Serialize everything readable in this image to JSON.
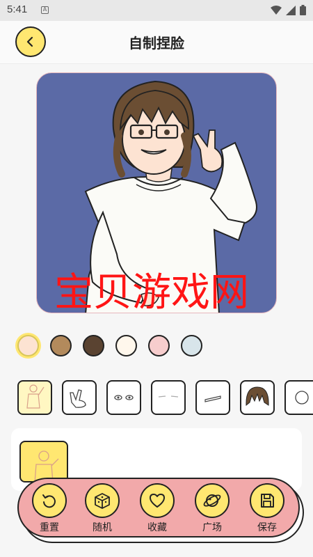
{
  "status": {
    "time": "5:41",
    "notification_letter": "A"
  },
  "header": {
    "title": "自制捏脸"
  },
  "watermark": {
    "text": "宝贝游戏网"
  },
  "colors": {
    "accent": "#ffe771",
    "action_bar": "#f2a9aa",
    "preview_background": "#5b6aa6",
    "swatches": [
      "#fde3d2",
      "#b38a5c",
      "#5a4331",
      "#fff7ec",
      "#f7cdcd",
      "#d8e5ea"
    ]
  },
  "parts": [
    "body",
    "hand",
    "eyes",
    "eyebrows",
    "mouth",
    "hair",
    "accessory"
  ],
  "options": [
    "body-pose"
  ],
  "actions": [
    {
      "id": "reset",
      "label": "重置",
      "icon": "reset-icon"
    },
    {
      "id": "random",
      "label": "随机",
      "icon": "dice-icon"
    },
    {
      "id": "favorite",
      "label": "收藏",
      "icon": "heart-icon"
    },
    {
      "id": "plaza",
      "label": "广场",
      "icon": "planet-icon"
    },
    {
      "id": "save",
      "label": "保存",
      "icon": "save-icon"
    }
  ]
}
